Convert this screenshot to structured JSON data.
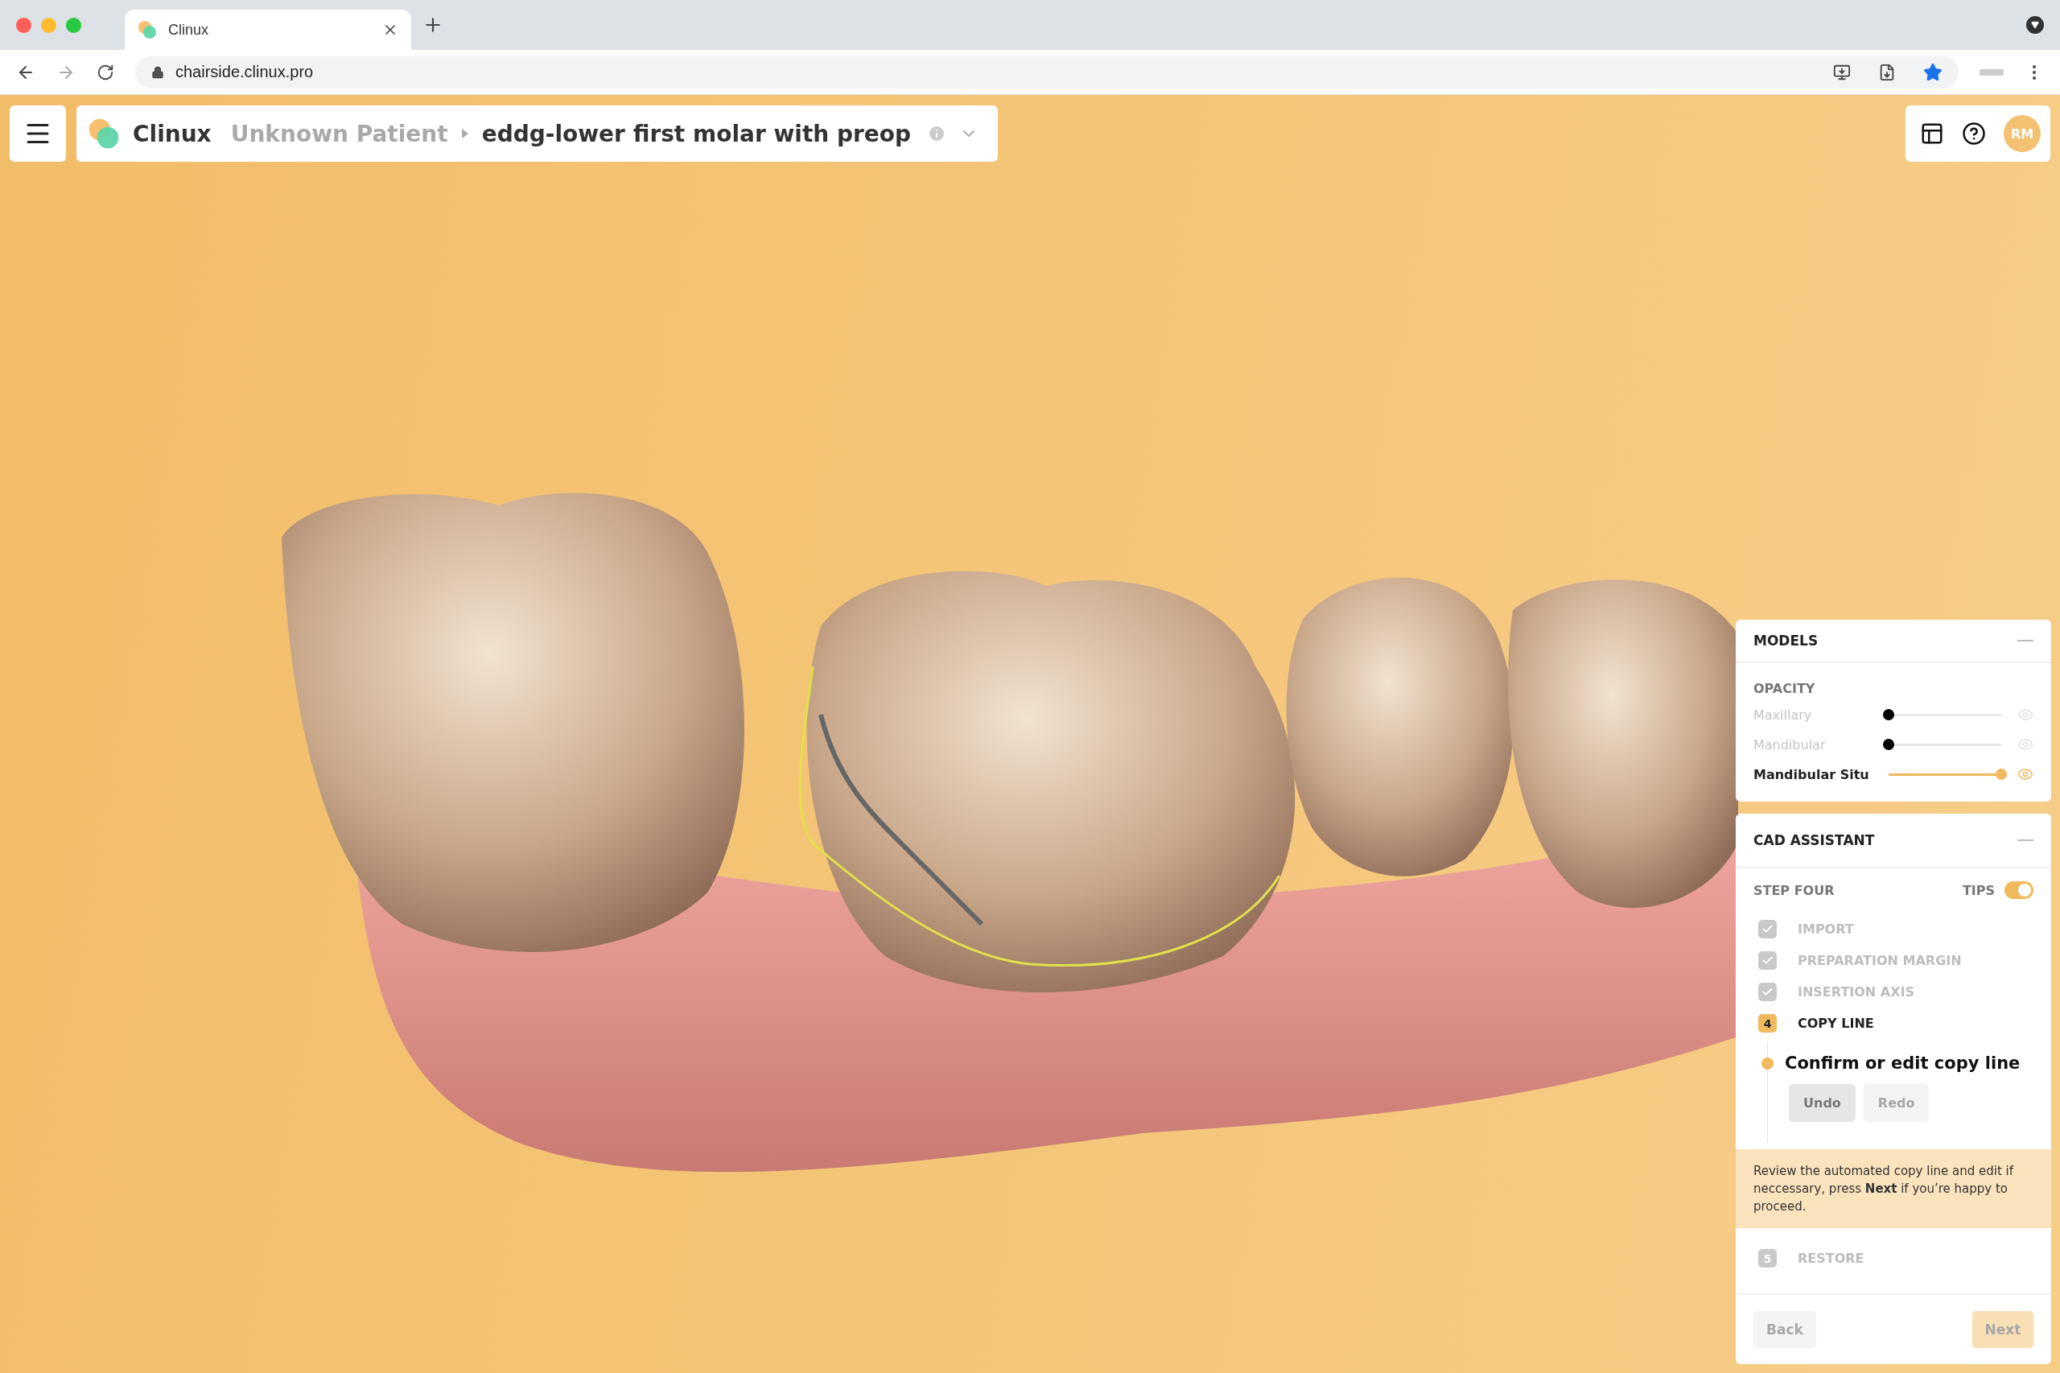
{
  "browser": {
    "tab_title": "Clinux",
    "url": "chairside.clinux.pro"
  },
  "header": {
    "brand": "Clinux",
    "patient": "Unknown Patient",
    "case": "eddg-lower first molar with preop",
    "avatar": "RM"
  },
  "models": {
    "title": "MODELS",
    "section": "OPACITY",
    "items": [
      {
        "name": "Maxillary",
        "level": 0,
        "visible": false
      },
      {
        "name": "Mandibular",
        "level": 0,
        "visible": false
      },
      {
        "name": "Mandibular Situ",
        "level": 1,
        "visible": true
      }
    ]
  },
  "assistant": {
    "title": "CAD ASSISTANT",
    "step": "STEP FOUR",
    "tips_label": "TIPS",
    "tips": true,
    "steps": [
      {
        "kind": "check",
        "checked": true,
        "label": "IMPORT"
      },
      {
        "kind": "check",
        "checked": true,
        "label": "PREPARATION MARGIN"
      },
      {
        "kind": "check",
        "checked": true,
        "label": "INSERTION AXIS"
      },
      {
        "kind": "number",
        "selected": true,
        "number": "4",
        "label": "COPY LINE",
        "task": "Confirm or edit copy line",
        "actions": [
          {
            "label": "Undo",
            "disabled": false
          },
          {
            "label": "Redo",
            "disabled": true
          }
        ],
        "tip": "Review the automated copy line and edit if neccessary, press **Next** if you’re happy to proceed."
      },
      {
        "kind": "number",
        "selected": false,
        "number": "5",
        "label": "RESTORE"
      }
    ],
    "back": {
      "label": "Back",
      "disabled": true
    },
    "next": {
      "label": "Next",
      "disabled": true
    }
  }
}
